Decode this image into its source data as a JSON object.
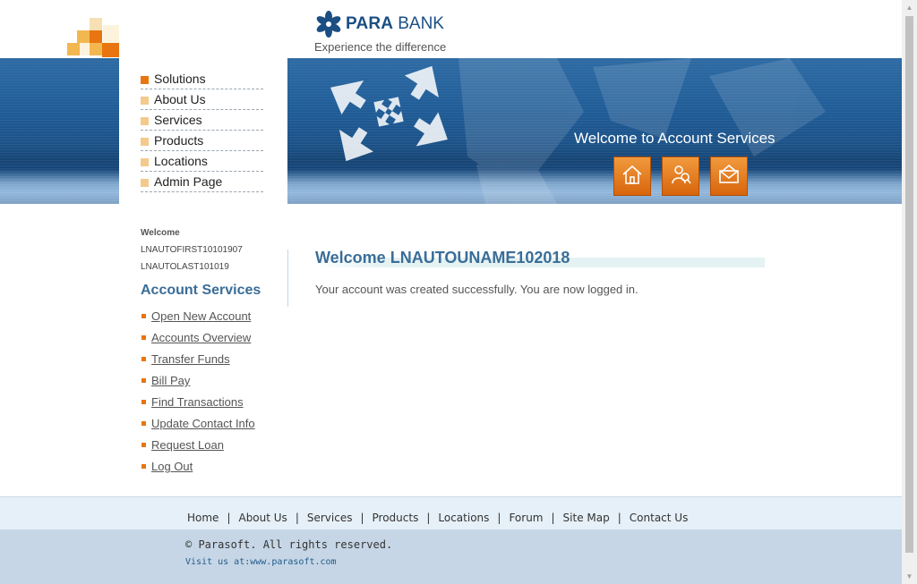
{
  "header": {
    "brand_bold": "PARA",
    "brand_regular": "BANK",
    "tagline": "Experience the difference",
    "logo_squares_colors": [
      "#f6e0b4",
      "#f3b750",
      "#e8750f",
      "#fdf3dc"
    ]
  },
  "banner": {
    "welcome": "Welcome to Account Services",
    "buttons": [
      {
        "icon": "home-icon"
      },
      {
        "icon": "about-icon"
      },
      {
        "icon": "contact-icon"
      }
    ]
  },
  "top_menu": {
    "items": [
      "Solutions",
      "About Us",
      "Services",
      "Products",
      "Locations",
      "Admin Page"
    ]
  },
  "user": {
    "welcome_label": "Welcome",
    "first_name": "LNAUTOFIRST10101907",
    "last_name": "LNAUTOLAST101019"
  },
  "account_services": {
    "heading": "Account Services",
    "links": [
      "Open New Account",
      "Accounts Overview",
      "Transfer Funds",
      "Bill Pay",
      "Find Transactions",
      "Update Contact Info",
      "Request Loan",
      "Log Out"
    ]
  },
  "main": {
    "title": "Welcome LNAUTOUNAME102018",
    "message": "Your account was created successfully. You are now logged in."
  },
  "footer": {
    "links": [
      "Home",
      "About Us",
      "Services",
      "Products",
      "Locations",
      "Forum",
      "Site Map",
      "Contact Us"
    ],
    "copyright": "© Parasoft. All rights reserved.",
    "visit_prefix": "Visit us at:",
    "visit_url": "www.parasoft.com"
  },
  "colors": {
    "accent_orange": "#e8750f",
    "brand_blue": "#1b4f84",
    "heading_blue": "#3a6d98"
  }
}
